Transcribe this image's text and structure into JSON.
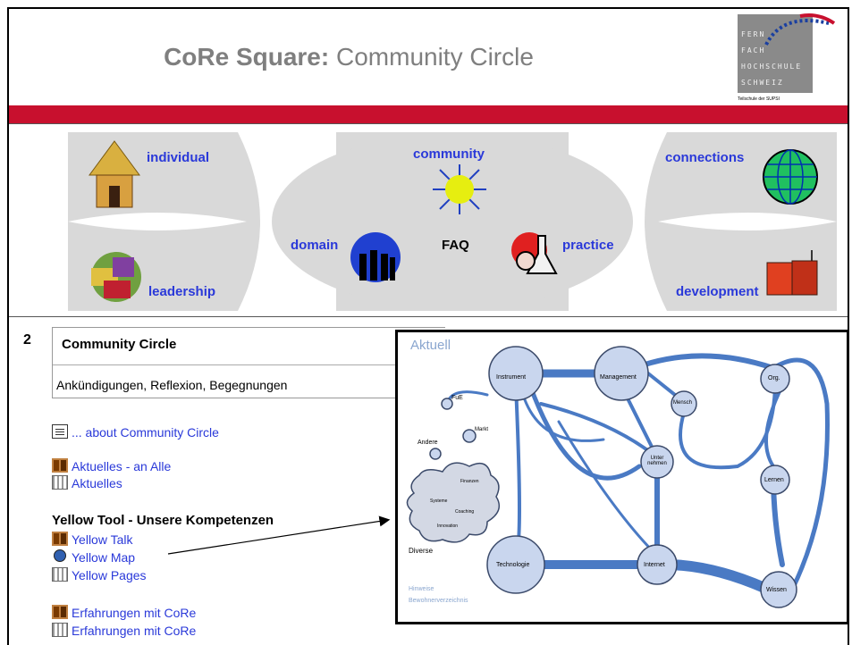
{
  "header": {
    "title_bold": "CoRe Square:",
    "title_rest": " Community Circle",
    "logo_lines": [
      "FERN",
      "FACH",
      "HOCHSCHULE",
      "SCHWEIZ"
    ],
    "logo_sub": "Teilschule der SUPSI"
  },
  "nav": {
    "individual": "individual",
    "community": "community",
    "connections": "connections",
    "domain": "domain",
    "faq": "FAQ",
    "practice": "practice",
    "leadership": "leadership",
    "development": "development"
  },
  "content": {
    "number": "2",
    "box_title": "Community Circle",
    "box_subtitle": "Ankündigungen, Reflexion, Begegnungen",
    "about_link": "... about Community Circle",
    "aktuelles_1": "Aktuelles - an Alle",
    "aktuelles_2": "Aktuelles",
    "yellow_tool_label": "Yellow Tool - Unsere Kompetenzen",
    "yellow_talk": "Yellow Talk",
    "yellow_map": "Yellow Map",
    "yellow_pages": "Yellow Pages",
    "erfahrungen_1": "Erfahrungen mit CoRe",
    "erfahrungen_2": "Erfahrungen mit CoRe"
  },
  "map": {
    "title": "Aktuell",
    "nodes": {
      "instrument": "Instrument",
      "management": "Management",
      "mensch": "Mensch",
      "org": "Org.",
      "fue": "FuE",
      "markt": "Markt",
      "andere": "Andere",
      "unternehmen": "Unter nehmen",
      "lernen": "Lernen",
      "technologie": "Technologie",
      "internet": "Internet",
      "wissen": "Wissen",
      "diverse": "Diverse",
      "finanzen": "Finanzen",
      "systeme": "Systeme",
      "coaching": "Coaching",
      "innovation": "Innovation"
    },
    "footer_1": "Hinweise",
    "footer_2": "Bewohnerverzeichnis"
  },
  "colors": {
    "accent_red": "#c8102e",
    "link_blue": "#2a39d9",
    "map_line": "#4a7ac4",
    "map_node": "#c9d6ee"
  }
}
